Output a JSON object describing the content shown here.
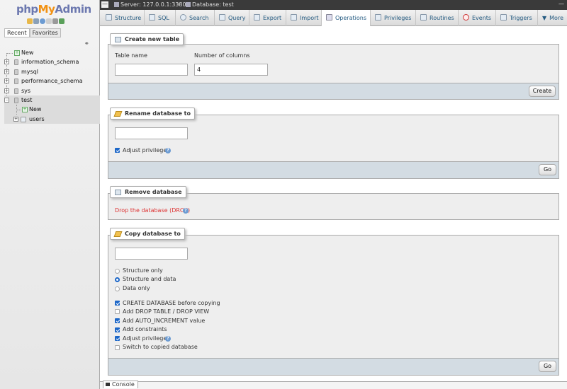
{
  "nav": {
    "logo": {
      "php": "php",
      "my": "My",
      "admin": "Admin"
    },
    "tabs": [
      "Recent",
      "Favorites"
    ],
    "tree": [
      {
        "label": "New"
      },
      {
        "label": "information_schema"
      },
      {
        "label": "mysql"
      },
      {
        "label": "performance_schema"
      },
      {
        "label": "sys"
      },
      {
        "label": "test"
      },
      {
        "label": "New"
      },
      {
        "label": "users"
      }
    ]
  },
  "topbar": {
    "server": "Server: 127.0.0.1:3380",
    "database": "Database: test"
  },
  "menu": [
    {
      "label": "Structure"
    },
    {
      "label": "SQL"
    },
    {
      "label": "Search"
    },
    {
      "label": "Query"
    },
    {
      "label": "Export"
    },
    {
      "label": "Import"
    },
    {
      "label": "Operations"
    },
    {
      "label": "Privileges"
    },
    {
      "label": "Routines"
    },
    {
      "label": "Events"
    },
    {
      "label": "Triggers"
    },
    {
      "label": "More"
    }
  ],
  "create_table": {
    "legend": "Create new table",
    "table_name_label": "Table name",
    "table_name_value": "",
    "columns_label": "Number of columns",
    "columns_value": "4",
    "button": "Create"
  },
  "rename_db": {
    "legend": "Rename database to",
    "value": "",
    "adjust_privileges": "Adjust privileges",
    "button": "Go"
  },
  "remove_db": {
    "legend": "Remove database",
    "drop_link": "Drop the database (DROP)"
  },
  "copy_db": {
    "legend": "Copy database to",
    "value": "",
    "radios": [
      {
        "label": "Structure only",
        "checked": false
      },
      {
        "label": "Structure and data",
        "checked": true
      },
      {
        "label": "Data only",
        "checked": false
      }
    ],
    "checks": [
      {
        "label": "CREATE DATABASE before copying",
        "checked": true
      },
      {
        "label": "Add DROP TABLE / DROP VIEW",
        "checked": false
      },
      {
        "label": "Add AUTO_INCREMENT value",
        "checked": true
      },
      {
        "label": "Add constraints",
        "checked": true
      },
      {
        "label": "Adjust privileges",
        "checked": true
      },
      {
        "label": "Switch to copied database",
        "checked": false
      }
    ],
    "button": "Go"
  },
  "console": {
    "label": "Console"
  },
  "colors": {
    "link": "#235a81",
    "accent": "#1d67c8",
    "danger": "#dd3333",
    "logo_orange": "#f29111",
    "logo_blue": "#6c78af"
  }
}
